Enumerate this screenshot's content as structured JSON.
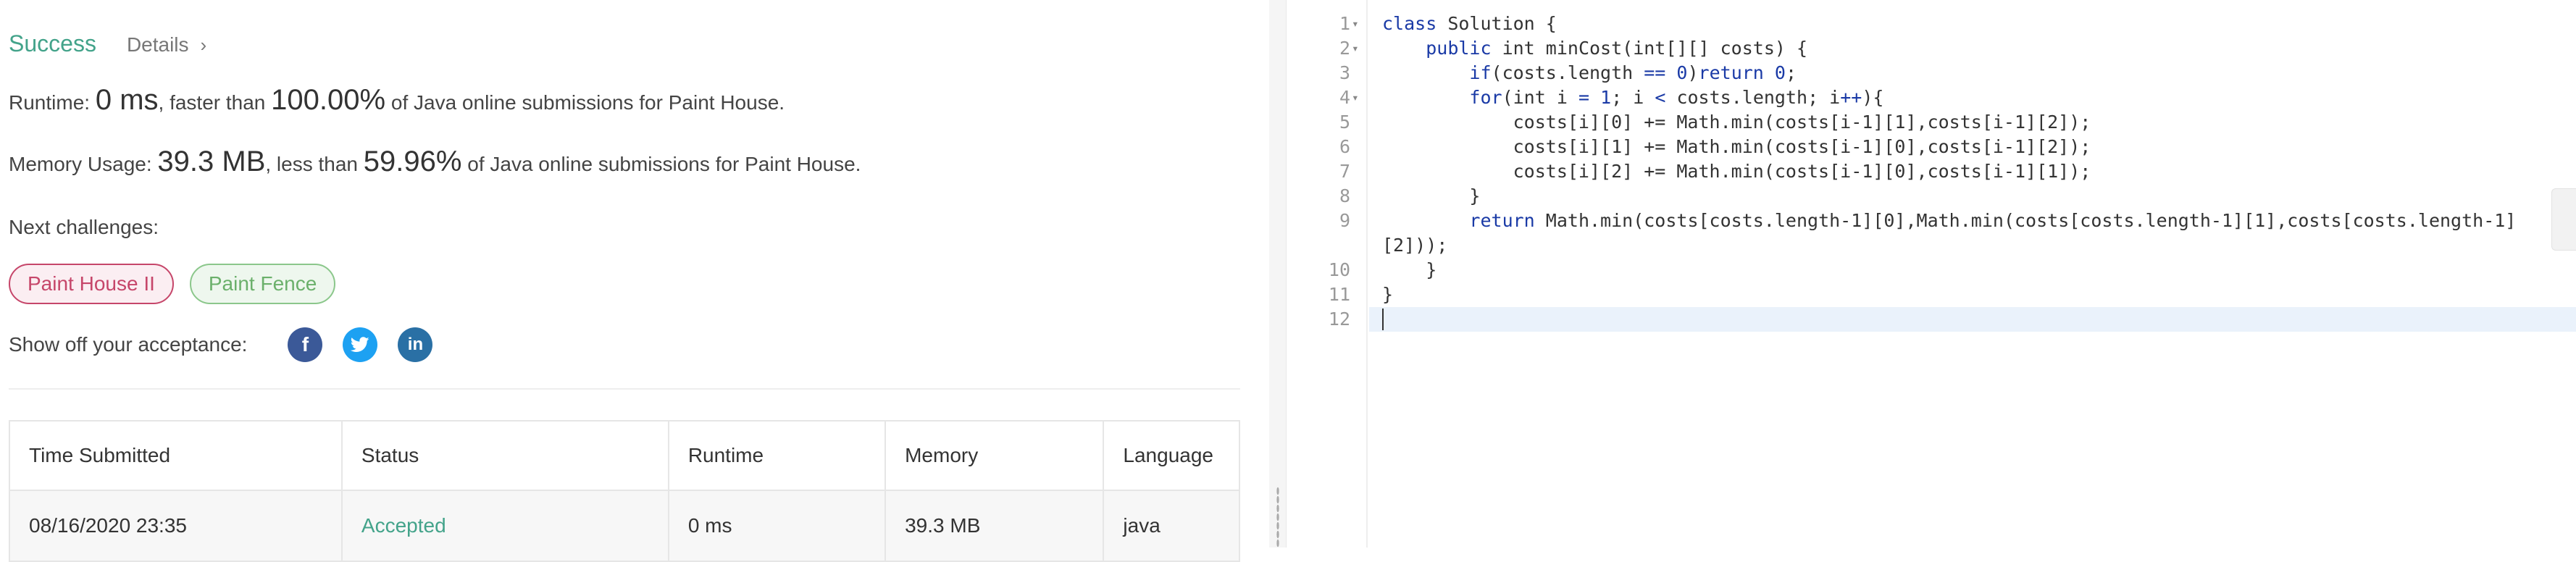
{
  "result": {
    "status": "Success",
    "details_label": "Details",
    "runtime_label": "Runtime:",
    "runtime_value": "0 ms",
    "runtime_mid": ", faster than",
    "runtime_percent": "100.00%",
    "runtime_suffix": "of Java online submissions for Paint House.",
    "memory_label": "Memory Usage:",
    "memory_value": "39.3 MB",
    "memory_mid": ", less than",
    "memory_percent": "59.96%",
    "memory_suffix": "of Java online submissions for Paint House.",
    "next_challenges_label": "Next challenges:",
    "challenges": [
      "Paint House II",
      "Paint Fence"
    ],
    "share_label": "Show off your acceptance:",
    "social_icons": [
      "facebook-icon",
      "twitter-icon",
      "linkedin-icon"
    ]
  },
  "table": {
    "headers": [
      "Time Submitted",
      "Status",
      "Runtime",
      "Memory",
      "Language"
    ],
    "rows": [
      [
        "08/16/2020 23:35",
        "Accepted",
        "0 ms",
        "39.3 MB",
        "java"
      ]
    ]
  },
  "editor": {
    "line_numbers": [
      "1",
      "2",
      "3",
      "4",
      "5",
      "6",
      "7",
      "8",
      "9",
      "10",
      "11",
      "12"
    ],
    "fold_lines": [
      "1",
      "2",
      "4"
    ],
    "code": {
      "l1a": "class",
      "l1b": " Solution {",
      "l2a": "    ",
      "l2b": "public",
      "l2c": " int minCost(int[][] costs) {",
      "l3a": "        ",
      "l3b": "if",
      "l3c": "(costs.length ",
      "l3d": "==",
      "l3e": " ",
      "l3f": "0",
      "l3g": ")",
      "l3h": "return",
      "l3i": " ",
      "l3j": "0",
      "l3k": ";",
      "l4a": "        ",
      "l4b": "for",
      "l4c": "(int i ",
      "l4d": "=",
      "l4e": " ",
      "l4f": "1",
      "l4g": "; i ",
      "l4h": "<",
      "l4i": " costs.length; i",
      "l4j": "++",
      "l4k": "){",
      "l5": "            costs[i][0] += Math.min(costs[i-1][1],costs[i-1][2]);",
      "l6": "            costs[i][1] += Math.min(costs[i-1][0],costs[i-1][2]);",
      "l7": "            costs[i][2] += Math.min(costs[i-1][0],costs[i-1][1]);",
      "l8": "        }",
      "l9a": "        ",
      "l9b": "return",
      "l9c": " Math.min(costs[costs.length-1][0],Math.min(costs[costs.length-1][1],costs[costs.length-1]",
      "l9wrap": "[2]));",
      "l10": "    }",
      "l11": "}",
      "l12": ""
    }
  },
  "colors": {
    "success": "#43a38a",
    "pill_red": "#c6466a",
    "pill_green": "#6bb06b",
    "keyword": "#1a3aa6"
  }
}
